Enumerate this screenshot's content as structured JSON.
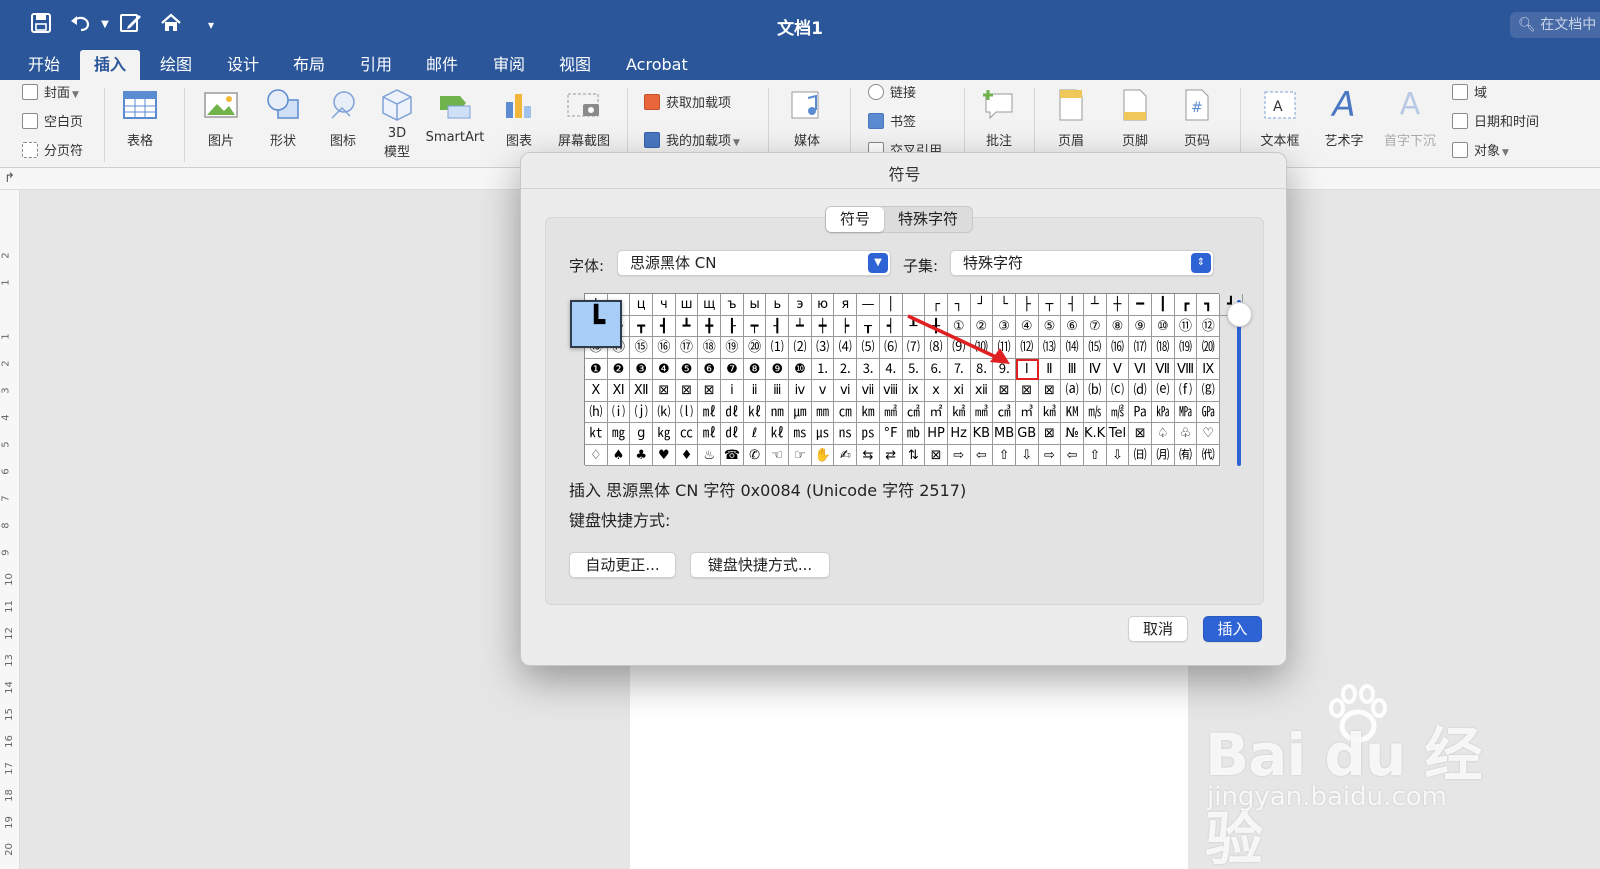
{
  "window": {
    "doc_title": "文档1",
    "search_placeholder": "在文档中"
  },
  "tabs": [
    "开始",
    "插入",
    "绘图",
    "设计",
    "布局",
    "引用",
    "邮件",
    "审阅",
    "视图",
    "Acrobat"
  ],
  "active_tab": "插入",
  "ribbon": {
    "cover": "封面",
    "blank_page": "空白页",
    "page_break": "分页符",
    "table": "表格",
    "pictures": "图片",
    "shapes": "形状",
    "icons": "图标",
    "model3d_line1": "3D",
    "model3d_line2": "模型",
    "smartart": "SmartArt",
    "chart": "图表",
    "screenshot": "屏幕截图",
    "get_addins": "获取加载项",
    "my_addins": "我的加载项",
    "media": "媒体",
    "link": "链接",
    "bookmark": "书签",
    "cross_ref": "交叉引用",
    "comment": "批注",
    "header": "页眉",
    "footer": "页脚",
    "page_number": "页码",
    "textbox": "文本框",
    "wordart": "艺术字",
    "dropcap": "首字下沉",
    "field": "域",
    "datetime": "日期和时间",
    "object": "对象"
  },
  "dialog": {
    "title": "符号",
    "tabs": [
      "符号",
      "特殊字符"
    ],
    "font_label": "字体:",
    "font_value": "思源黑体 CN",
    "subset_label": "子集:",
    "subset_value": "特殊字符",
    "zoom_char": "┗",
    "grid_rows": [
      [
        "ф",
        "х",
        "ц",
        "ч",
        "ш",
        "щ",
        "ъ",
        "ы",
        "ь",
        "э",
        "ю",
        "я",
        "—",
        "│",
        "",
        "┌",
        "┐",
        "┘",
        "└",
        "├",
        "┬",
        "┤",
        "┴",
        "┼",
        "━",
        "┃",
        "┏",
        "┓",
        "┛"
      ],
      [
        "┗",
        "┣",
        "┳",
        "┫",
        "┻",
        "╋",
        "┠",
        "┯",
        "┨",
        "┷",
        "┿",
        "┝",
        "┰",
        "┥",
        "┸",
        "╂",
        "①",
        "②",
        "③",
        "④",
        "⑤",
        "⑥",
        "⑦",
        "⑧",
        "⑨",
        "⑩",
        "⑪",
        "⑫"
      ],
      [
        "⑬",
        "⑭",
        "⑮",
        "⑯",
        "⑰",
        "⑱",
        "⑲",
        "⑳",
        "⑴",
        "⑵",
        "⑶",
        "⑷",
        "⑸",
        "⑹",
        "⑺",
        "⑻",
        "⑼",
        "⑽",
        "⑾",
        "⑿",
        "⒀",
        "⒁",
        "⒂",
        "⒃",
        "⒄",
        "⒅",
        "⒆",
        "⒇"
      ],
      [
        "❶",
        "❷",
        "❸",
        "❹",
        "❺",
        "❻",
        "❼",
        "❽",
        "❾",
        "❿",
        "⒈",
        "⒉",
        "⒊",
        "⒋",
        "⒌",
        "⒍",
        "⒎",
        "⒏",
        "⒐",
        "Ⅰ",
        "Ⅱ",
        "Ⅲ",
        "Ⅳ",
        "Ⅴ",
        "Ⅵ",
        "Ⅶ",
        "Ⅷ",
        "Ⅸ"
      ],
      [
        "Ⅹ",
        "Ⅺ",
        "Ⅻ",
        "⊠",
        "⊠",
        "⊠",
        "ⅰ",
        "ⅱ",
        "ⅲ",
        "ⅳ",
        "ⅴ",
        "ⅵ",
        "ⅶ",
        "ⅷ",
        "ⅸ",
        "ⅹ",
        "ⅺ",
        "ⅻ",
        "⊠",
        "⊠",
        "⊠",
        "⒜",
        "⒝",
        "⒞",
        "⒟",
        "⒠",
        "⒡",
        "⒢"
      ],
      [
        "⒣",
        "⒤",
        "⒥",
        "⒦",
        "⒧",
        "㎖",
        "㎗",
        "㎘",
        "㎚",
        "㎛",
        "㎜",
        "㎝",
        "㎞",
        "㎟",
        "㎠",
        "㎡",
        "㎢",
        "㎣",
        "㎤",
        "㎥",
        "㎦",
        "㏎",
        "㎧",
        "㎨",
        "㎩",
        "㎪",
        "㎫",
        "㎬"
      ],
      [
        "㏏",
        "㎎",
        "g",
        "㎏",
        "㏄",
        "㎖",
        "㎗",
        "ℓ",
        "㎘",
        "㎳",
        "㎲",
        "㎱",
        "㎰",
        "°F",
        "㏔",
        "HP",
        "Hz",
        "KB",
        "MB",
        "GB",
        "⊠",
        "№",
        "K.K.",
        "Tel",
        "⊠",
        "♤",
        "♧",
        "♡"
      ],
      [
        "♢",
        "♠",
        "♣",
        "♥",
        "♦",
        "♨",
        "☎",
        "✆",
        "☜",
        "☞",
        "✋",
        "✍",
        "⇆",
        "⇄",
        "⇅",
        "⊠",
        "⇨",
        "⇦",
        "⇧",
        "⇩",
        "⇨",
        "⇦",
        "⇧",
        "⇩",
        "㈰",
        "㈪",
        "㈲",
        "㈹"
      ]
    ],
    "selected_cell": "Ⅰ",
    "info_line": "插入 思源黑体 CN 字符 0x0084 (Unicode 字符 2517)",
    "shortcut_label": "键盘快捷方式:",
    "autocorrect_btn": "自动更正...",
    "shortcut_btn": "键盘快捷方式...",
    "cancel_btn": "取消",
    "insert_btn": "插入"
  },
  "watermark": {
    "brand": "Bai  du 经验",
    "url": "jingyan.baidu.com"
  },
  "colors": {
    "title_bar": "#2b579a",
    "accent_blue": "#2e63d6",
    "highlight_red": "#e02020",
    "zoom_bg": "#a8cdf6"
  }
}
